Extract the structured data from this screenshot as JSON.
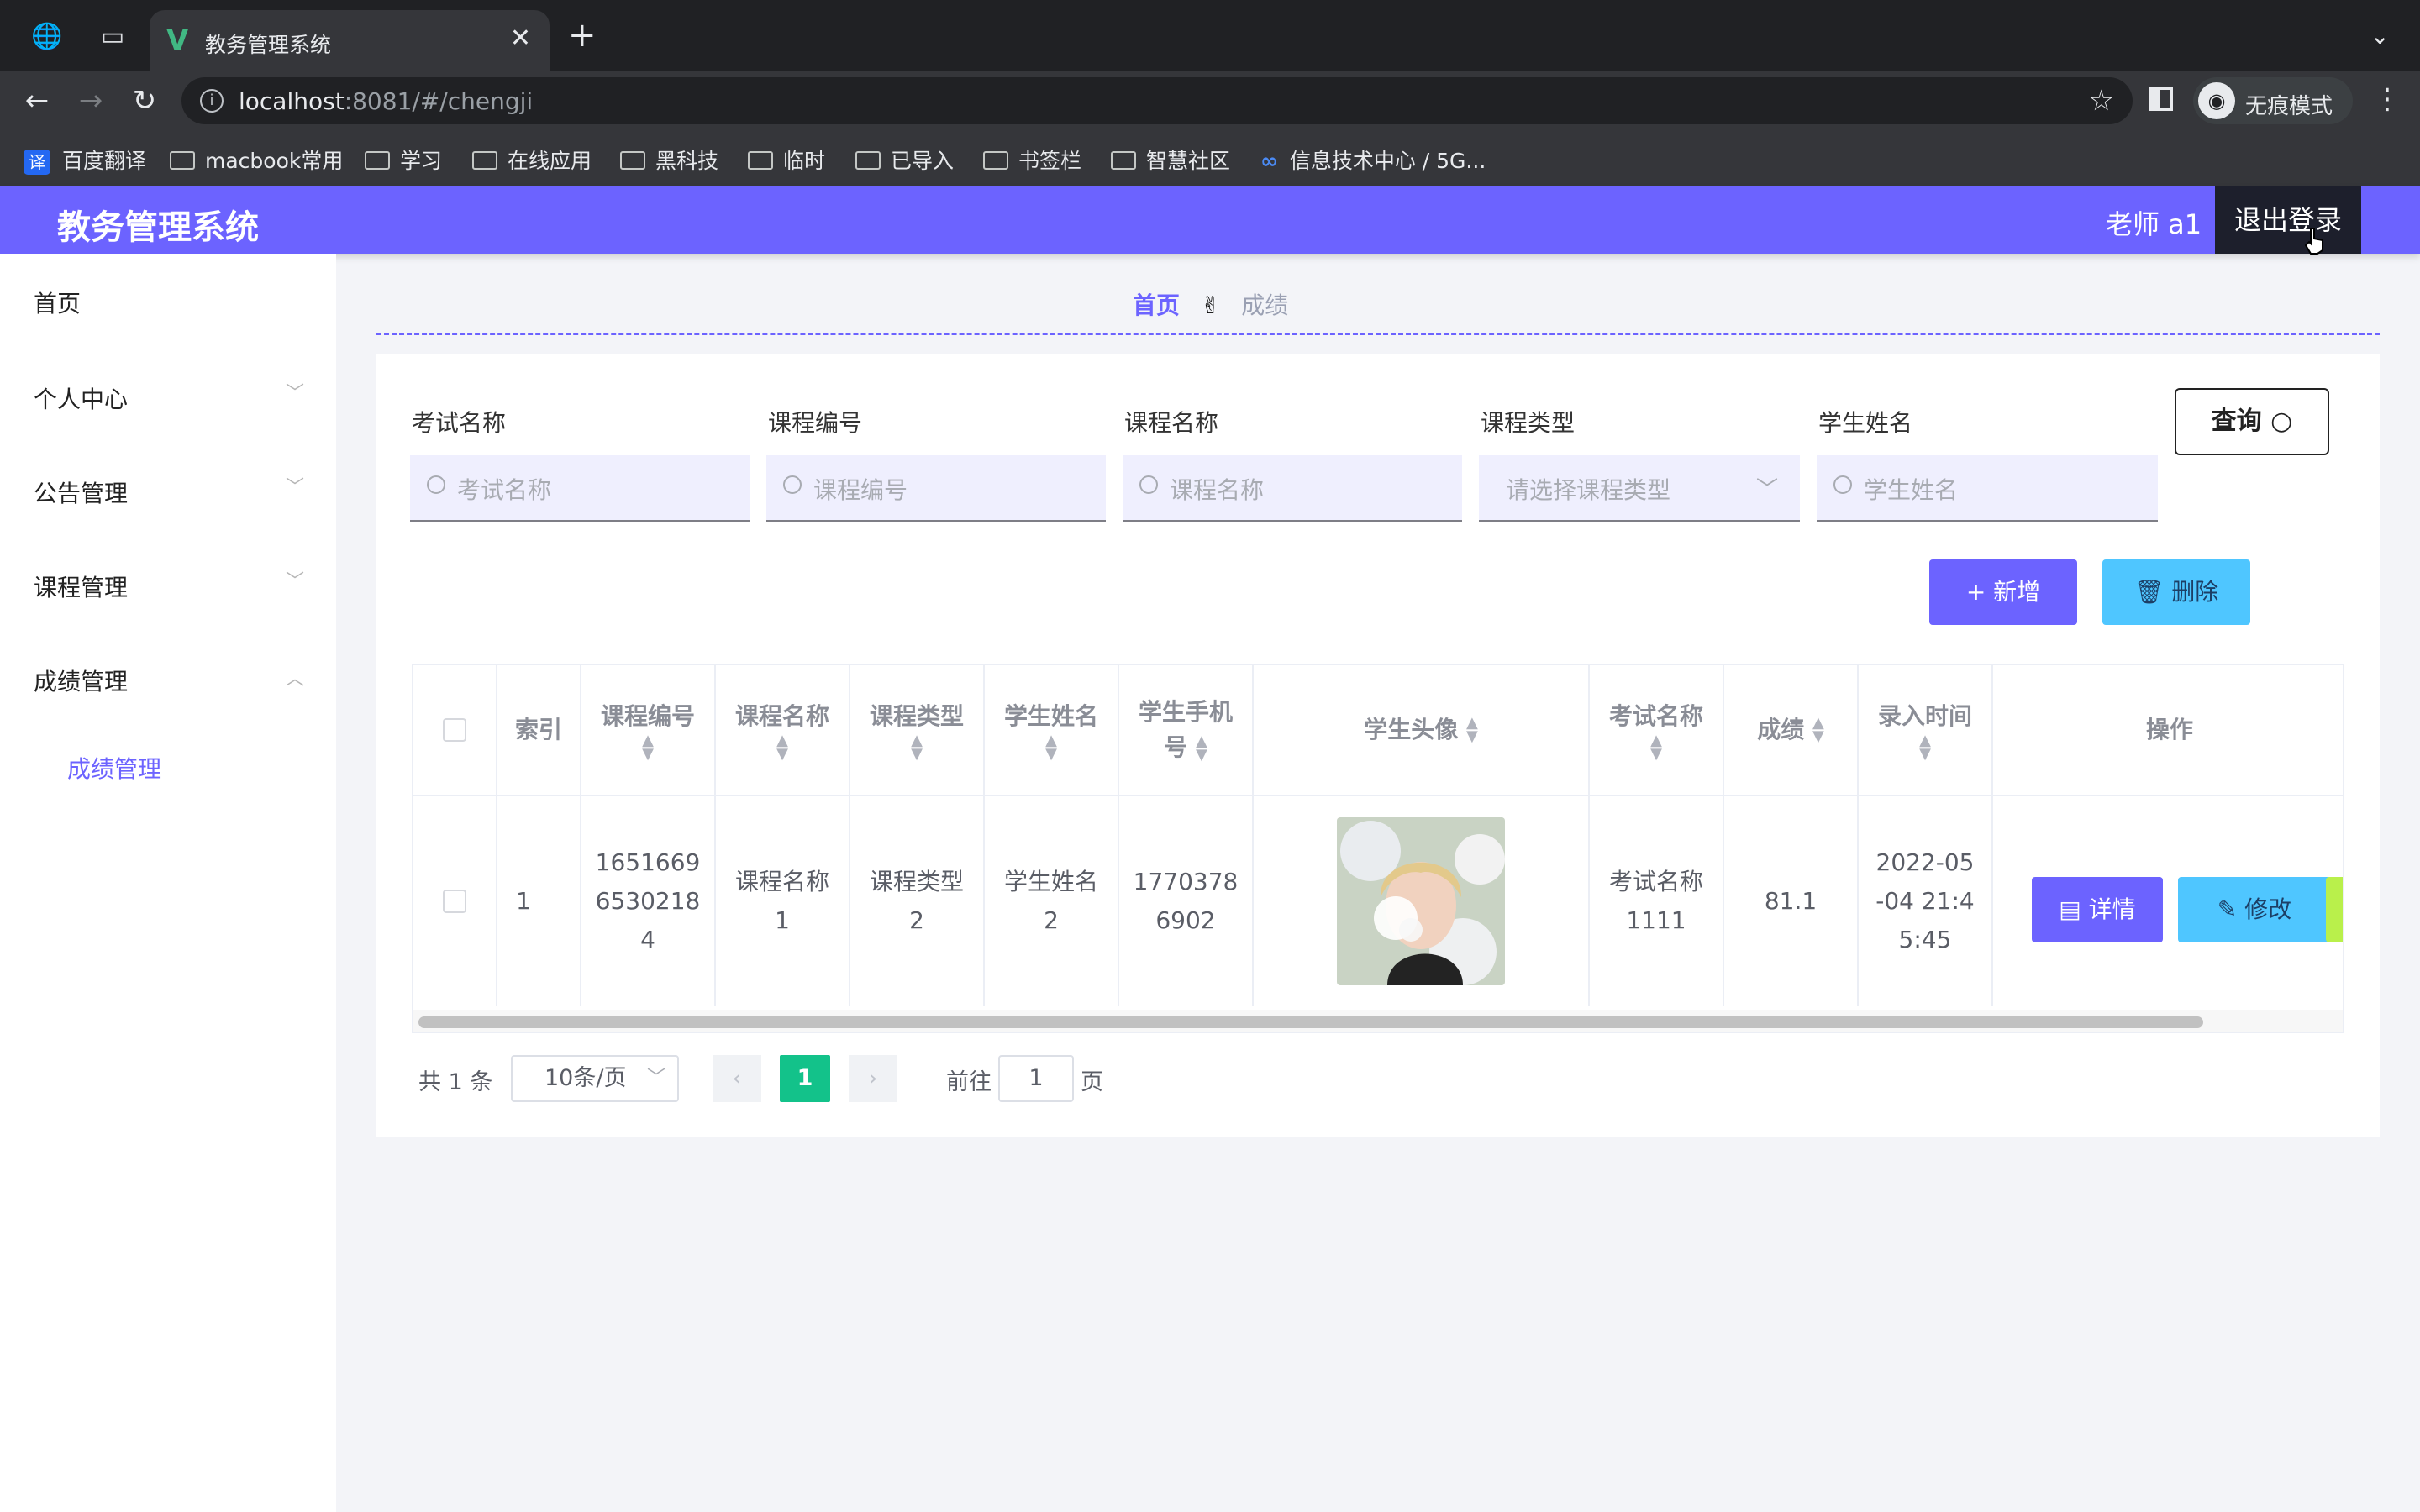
{
  "browser": {
    "tab_title": "教务管理系统",
    "url_host": "localhost",
    "url_path": ":8081/#/chengji",
    "incognito_label": "无痕模式",
    "bookmarks": [
      "百度翻译",
      "macbook常用",
      "学习",
      "在线应用",
      "黑科技",
      "临时",
      "已导入",
      "书签栏",
      "智慧社区",
      "信息技术中心 / 5G..."
    ],
    "baidu_icon_text": "译"
  },
  "app": {
    "brand": "教务管理系统",
    "user": "老师 a1",
    "logout": "退出登录",
    "accent": "#6c63ff"
  },
  "sidebar": {
    "items": [
      {
        "label": "首页"
      },
      {
        "label": "个人中心"
      },
      {
        "label": "公告管理"
      },
      {
        "label": "课程管理"
      },
      {
        "label": "成绩管理"
      }
    ],
    "sub_active": "成绩管理"
  },
  "breadcrumb": {
    "home": "首页",
    "sep": "✌",
    "current": "成绩"
  },
  "filters": {
    "exam_label": "考试名称",
    "exam_ph": "考试名称",
    "code_label": "课程编号",
    "code_ph": "课程编号",
    "name_label": "课程名称",
    "name_ph": "课程名称",
    "type_label": "课程类型",
    "type_ph": "请选择课程类型",
    "student_label": "学生姓名",
    "student_ph": "学生姓名",
    "query": "查询"
  },
  "actions": {
    "add": "+ 新增",
    "delete": "删除"
  },
  "table": {
    "headers": {
      "index": "索引",
      "code": "课程编号",
      "name": "课程名称",
      "type": "课程类型",
      "student": "学生姓名",
      "phone_1": "学生手机",
      "phone_2": "号",
      "avatar": "学生头像",
      "exam": "考试名称",
      "score": "成绩",
      "time": "录入时间",
      "ops": "操作"
    },
    "row": {
      "index": "1",
      "code_1": "1651669",
      "code_2": "6530218",
      "code_3": "4",
      "name_1": "课程名称",
      "name_2": "1",
      "type_1": "课程类型",
      "type_2": "2",
      "student_1": "学生姓名",
      "student_2": "2",
      "phone_1": "1770378",
      "phone_2": "6902",
      "exam_1": "考试名称",
      "exam_2": "1111",
      "score": "81.1",
      "time_1": "2022-05",
      "time_2": "-04 21:4",
      "time_3": "5:45",
      "detail": "详情",
      "edit": "修改"
    }
  },
  "pagination": {
    "total": "共 1 条",
    "page_size": "10条/页",
    "current": "1",
    "goto": "前往",
    "goto_value": "1",
    "unit": "页"
  }
}
